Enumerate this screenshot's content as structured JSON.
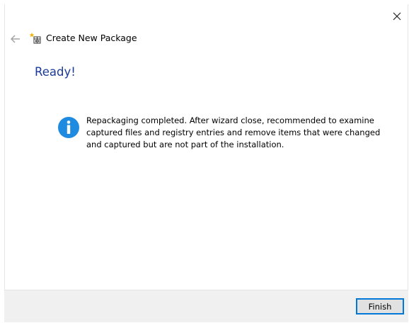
{
  "window": {
    "title": "Create New Package"
  },
  "page": {
    "heading": "Ready!",
    "message": "Repackaging completed. After wizard close, recommended to examine captured files and registry entries and remove items that were changed and captured but are not part of the installation."
  },
  "footer": {
    "finish_label": "Finish"
  },
  "icons": {
    "close": "close-icon",
    "back": "back-arrow-icon",
    "app": "new-package-icon",
    "info": "info-icon"
  },
  "colors": {
    "heading": "#1a3a9a",
    "info_icon": "#1e8ae0",
    "button_border": "#0078d7",
    "footer_bg": "#f0f0f0"
  }
}
